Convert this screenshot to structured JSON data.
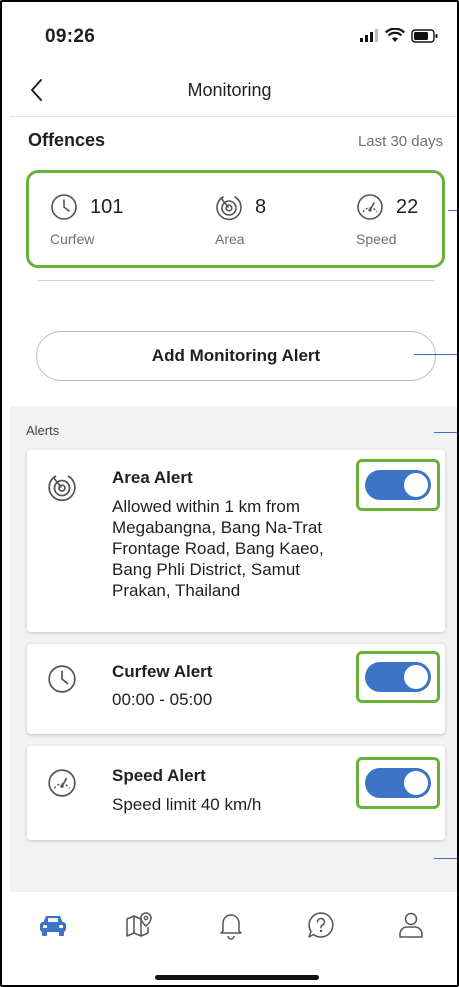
{
  "status_bar": {
    "time": "09:26"
  },
  "header": {
    "title": "Monitoring"
  },
  "offences": {
    "title": "Offences",
    "range": "Last 30 days",
    "stats": [
      {
        "icon": "clock-icon",
        "count": "101",
        "label": "Curfew"
      },
      {
        "icon": "area-target-icon",
        "count": "8",
        "label": "Area"
      },
      {
        "icon": "speedometer-icon",
        "count": "22",
        "label": "Speed"
      }
    ]
  },
  "add_button": {
    "label": "Add Monitoring Alert"
  },
  "alerts": {
    "label": "Alerts",
    "items": [
      {
        "icon": "area-target-icon",
        "title": "Area Alert",
        "description": "Allowed within 1 km from Megabangna, Bang Na-Trat Frontage Road, Bang Kaeo, Bang Phli District, Samut Prakan, Thailand",
        "enabled": true
      },
      {
        "icon": "clock-icon",
        "title": "Curfew Alert",
        "description": "00:00 - 05:00",
        "enabled": true
      },
      {
        "icon": "speedometer-icon",
        "title": "Speed Alert",
        "description": "Speed limit 40 km/h",
        "enabled": true
      }
    ]
  },
  "tabbar": {
    "items": [
      {
        "icon": "car-icon",
        "active": true
      },
      {
        "icon": "map-pin-icon",
        "active": false
      },
      {
        "icon": "bell-icon",
        "active": false
      },
      {
        "icon": "help-icon",
        "active": false
      },
      {
        "icon": "profile-icon",
        "active": false
      }
    ]
  },
  "colors": {
    "accent": "#3d73c6",
    "highlight": "#6ab13b",
    "background_alerts": "#f2f2f2"
  }
}
